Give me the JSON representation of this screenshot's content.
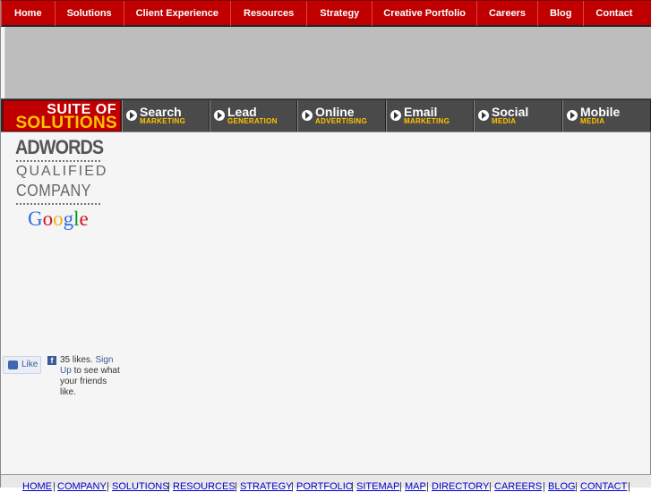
{
  "topnav": [
    {
      "label": "Home"
    },
    {
      "label": "Solutions"
    },
    {
      "label": "Client Experience"
    },
    {
      "label": "Resources"
    },
    {
      "label": "Strategy"
    },
    {
      "label": "Creative Portfolio"
    },
    {
      "label": "Careers"
    },
    {
      "label": "Blog"
    },
    {
      "label": "Contact"
    }
  ],
  "suite": {
    "logo_line1": "SUITE OF",
    "logo_line2": "SOLUTIONS",
    "services": [
      {
        "t1": "Search",
        "t2": "MARKETING"
      },
      {
        "t1": "Lead",
        "t2": "GENERATION"
      },
      {
        "t1": "Online",
        "t2": "ADVERTISING"
      },
      {
        "t1": "Email",
        "t2": "MARKETING"
      },
      {
        "t1": "Social",
        "t2": "MEDIA"
      },
      {
        "t1": "Mobile",
        "t2": "MEDIA"
      }
    ]
  },
  "adwords": {
    "line1": "ADWORDS",
    "line2": "QUALIFIED",
    "line3": "COMPANY",
    "google": "Google"
  },
  "facebook": {
    "like_label": "Like",
    "count_text": "35 likes.",
    "signup": "Sign Up",
    "rest": "to see what your friends like."
  },
  "footer": [
    "HOME",
    "COMPANY",
    "SOLUTIONS",
    "RESOURCES",
    "STRATEGY",
    "PORTFOLIO",
    "SITEMAP",
    "MAP",
    "DIRECTORY",
    "CAREERS",
    "BLOG",
    "CONTACT"
  ],
  "colors": {
    "nav_red": "#c00000",
    "accent_yellow": "#ffc400",
    "banner_gray": "#bdbdbd",
    "link_blue": "#0000cc"
  }
}
